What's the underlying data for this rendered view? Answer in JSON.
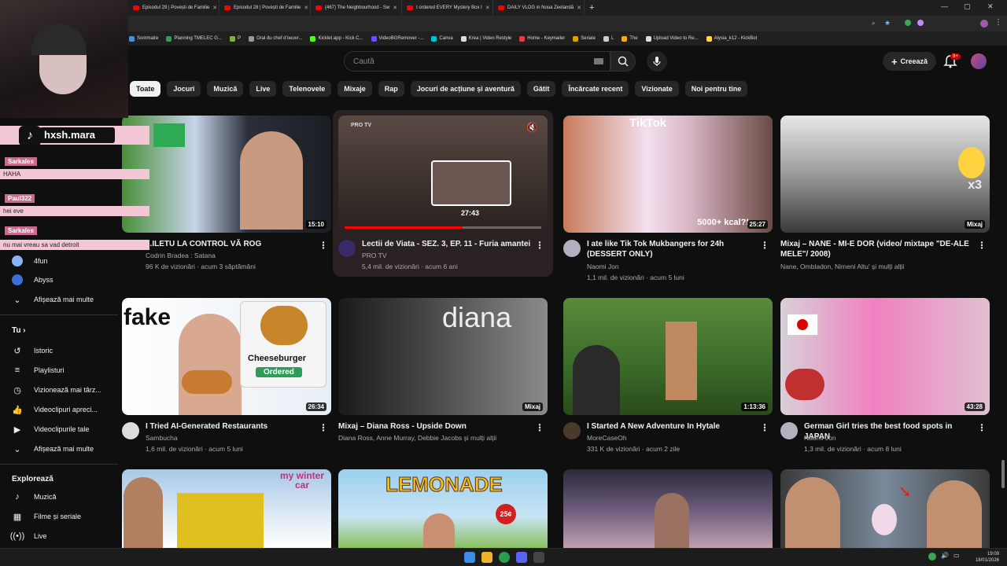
{
  "browser": {
    "tabs": [
      {
        "title": "Episodul 29 | Povești de Familie"
      },
      {
        "title": "Episodul 28 | Povești de Familie"
      },
      {
        "title": "(467) The Neighbourhood - Sw"
      },
      {
        "title": "I ordered EVERY Mystery Box I"
      },
      {
        "title": "DAILY VLOG in Noua Zeelandă"
      }
    ],
    "bookmarks": [
      "Sommaire",
      "Planning TMELEC G...",
      "P",
      "Oral du chef d'oeuvr...",
      "Kicklet.app - Kick C...",
      "VideoBGRemover -...",
      "Canva",
      "Krea | Video Restyle",
      "Home - Keymailer",
      "Seriale",
      "L",
      "The",
      "Upload Video to Re...",
      "Alysia_k12 - KickBot"
    ]
  },
  "header": {
    "search_placeholder": "Caută",
    "create_label": "Creează",
    "notifications_badge": "9+"
  },
  "chips": [
    "Toate",
    "Jocuri",
    "Muzică",
    "Live",
    "Telenovele",
    "Mixaje",
    "Rap",
    "Jocuri de acțiune și aventură",
    "Gătit",
    "Încărcate recent",
    "Vizionate",
    "Noi pentru tine"
  ],
  "sidebar": {
    "subs": [
      {
        "label": "4fun"
      },
      {
        "label": "Abyss"
      }
    ],
    "show_more_1": "Afișează mai multe",
    "you_heading": "Tu",
    "you_items": [
      {
        "label": "Istoric",
        "icon": "history-icon"
      },
      {
        "label": "Playlisturi",
        "icon": "playlist-icon"
      },
      {
        "label": "Vizionează mai târz...",
        "icon": "watch-later-icon"
      },
      {
        "label": "Videoclipuri apreci...",
        "icon": "like-icon"
      },
      {
        "label": "Videoclipurile tale",
        "icon": "your-videos-icon"
      }
    ],
    "show_more_2": "Afișează mai multe",
    "explore_heading": "Explorează",
    "explore_items": [
      {
        "label": "Muzică",
        "icon": "music-icon"
      },
      {
        "label": "Filme și seriale",
        "icon": "film-icon"
      },
      {
        "label": "Live",
        "icon": "live-icon"
      }
    ]
  },
  "videos": [
    {
      "title": "...ILETU LA CONTROL VĂ ROG",
      "channel": "Codrin Bradea : Satana",
      "meta": "96 K de vizionări · acum 3 săptămâni",
      "duration": "15:10"
    },
    {
      "title": "Lectii de Viata - SEZ. 3, EP. 11 - Furia amantei",
      "channel": "PRO TV",
      "meta": "5,4 mil. de vizionări · acum 6 ani",
      "duration": "",
      "preview_time": "27:43",
      "logo": "PRO TV",
      "progress": 0.6
    },
    {
      "title": "I ate like Tik Tok Mukbangers for 24h (DESSERT ONLY)",
      "channel": "Naomi Jon",
      "meta": "1,1 mil. de vizionări · acum 5 luni",
      "duration": "25:27",
      "overlay": "5000+ kcal?!"
    },
    {
      "title": "Mixaj – NANE - MI-E DOR (video/ mixtape \"DE-ALE MELE\"/ 2008)",
      "channel": "Nane, Ombladon, Nimeni Altu' și mulți alții",
      "meta": "",
      "duration": "Mixaj"
    },
    {
      "title": "I Tried AI-Generated Restaurants",
      "channel": "Sambucha",
      "meta": "1,6 mil. de vizionări · acum 5 luni",
      "duration": "26:34",
      "overlay_fake": "fake",
      "overlay_burger": "Cheeseburger",
      "overlay_ordered": "Ordered"
    },
    {
      "title": "Mixaj – Diana Ross - Upside Down",
      "channel": "Diana Ross, Anne Murray, Debbie Jacobs și mulți alții",
      "meta": "",
      "duration": "Mixaj",
      "overlay": "diana"
    },
    {
      "title": "I Started A New Adventure In Hytale",
      "channel": "MoreCaseOh",
      "meta": "331 K de vizionări · acum 2 zile",
      "duration": "1:13:36"
    },
    {
      "title": "German Girl tries the best food spots in JAPAN",
      "channel": "Naomi Jon",
      "meta": "1,3 mil. de vizionări · acum 8 luni",
      "duration": "43:28"
    },
    {
      "title": "",
      "channel": "",
      "meta": "",
      "duration": "",
      "overlay": "my winter car"
    },
    {
      "title": "",
      "channel": "",
      "meta": "",
      "duration": "",
      "overlay": "LEMONADE",
      "overlay_price": "25¢"
    },
    {
      "title": "",
      "channel": "",
      "meta": "",
      "duration": ""
    },
    {
      "title": "",
      "channel": "",
      "meta": "",
      "duration": ""
    }
  ],
  "overlay": {
    "tiktok_handle": "hxsh.mara",
    "chat": [
      {
        "user": "Sarkales",
        "msg": "HAHA"
      },
      {
        "user": "Paul322",
        "msg": "hei eve"
      },
      {
        "user": "Sarkales",
        "msg": "nu mai vreau sa vad detroit"
      }
    ],
    "x3": "x3"
  },
  "clock": {
    "time": "19:09",
    "date": "18/01/2026"
  },
  "colors": {
    "bg": "#0f0f0f",
    "chip": "#272727",
    "accent": "#ff0000",
    "chat_pink": "#f4c7d6"
  }
}
